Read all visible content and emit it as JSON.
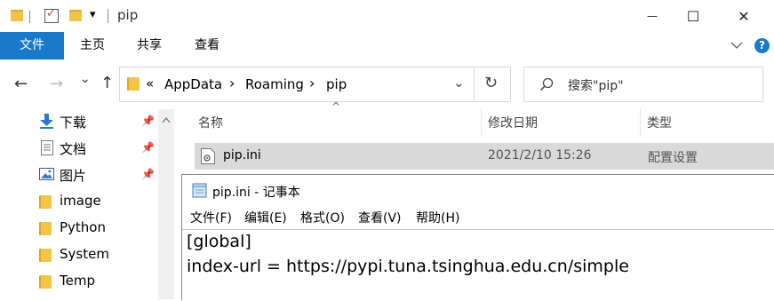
{
  "titlebar": {
    "title": "pip",
    "quick_access_dropdown": "▾"
  },
  "window_controls": {
    "minimize": "—",
    "maximize": "☐",
    "close": "✕"
  },
  "ribbon": {
    "tabs": [
      {
        "label": "文件",
        "active": true
      },
      {
        "label": "主页",
        "active": false
      },
      {
        "label": "共享",
        "active": false
      },
      {
        "label": "查看",
        "active": false
      }
    ],
    "expand_icon": "chevron-down-icon",
    "help_label": "?"
  },
  "navigation": {
    "back": "←",
    "forward": "→",
    "recent": "⌄",
    "up": "↑",
    "address": {
      "overflow": "«",
      "crumbs": [
        "AppData",
        "Roaming",
        "pip"
      ],
      "separator": "›",
      "dropdown": "⌄",
      "refresh": "↻"
    },
    "search": {
      "placeholder": "搜索\"pip\"",
      "icon": "search-icon"
    }
  },
  "sidebar": {
    "items": [
      {
        "label": "下载",
        "icon": "download-icon",
        "pinned": true
      },
      {
        "label": "文档",
        "icon": "document-icon",
        "pinned": true
      },
      {
        "label": "图片",
        "icon": "picture-icon",
        "pinned": true
      },
      {
        "label": "image",
        "icon": "folder-icon",
        "pinned": false
      },
      {
        "label": "Python",
        "icon": "folder-icon",
        "pinned": false
      },
      {
        "label": "System",
        "icon": "folder-icon",
        "pinned": false
      },
      {
        "label": "Temp",
        "icon": "folder-icon",
        "pinned": false
      }
    ],
    "pin_glyph": "📌"
  },
  "file_list": {
    "sort_indicator": "^",
    "columns": [
      "名称",
      "修改日期",
      "类型"
    ],
    "rows": [
      {
        "name": "pip.ini",
        "modified": "2021/2/10 15:26",
        "type": "配置设置",
        "icon": "config-file-icon",
        "selected": true
      }
    ]
  },
  "notepad": {
    "title": "pip.ini - 记事本",
    "menu": [
      "文件(F)",
      "编辑(E)",
      "格式(O)",
      "查看(V)",
      "帮助(H)"
    ],
    "content_lines": [
      "[global]",
      "index-url = https://pypi.tuna.tsinghua.edu.cn/simple"
    ]
  },
  "colors": {
    "accent": "#1979ca",
    "selection": "#d9d9d9",
    "folder": "#f0c24b"
  }
}
